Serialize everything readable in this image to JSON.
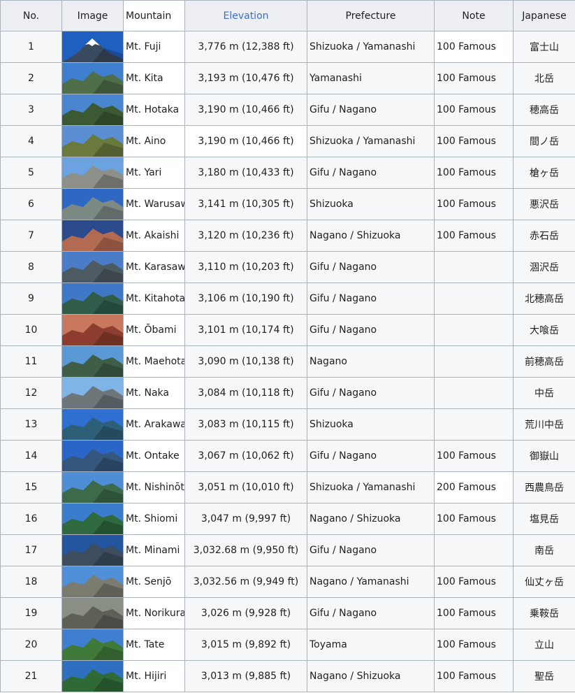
{
  "headers": [
    "No.",
    "Image",
    "Mountain",
    "Elevation",
    "Prefecture",
    "Note",
    "Japanese"
  ],
  "rows": [
    {
      "no": "1",
      "name": "Mt. Fuji",
      "elev": "3,776 m (12,388 ft)",
      "pref": "Shizuoka / Yamanashi",
      "note": "100 Famous",
      "jp": "富士山",
      "sky": "#1f5fbf",
      "rock": "#3a4a5e",
      "snow": true
    },
    {
      "no": "2",
      "name": "Mt. Kita",
      "elev": "3,193 m (10,476 ft)",
      "pref": "Yamanashi",
      "note": "100 Famous",
      "jp": "北岳",
      "sky": "#3e7fd0",
      "rock": "#4f6e4a"
    },
    {
      "no": "3",
      "name": "Mt. Hotaka",
      "elev": "3,190 m (10,466 ft)",
      "pref": "Gifu / Nagano",
      "note": "100 Famous",
      "jp": "穂高岳",
      "sky": "#4a86cf",
      "rock": "#3b5a34"
    },
    {
      "no": "4",
      "name": "Mt. Aino",
      "elev": "3,190 m (10,466 ft)",
      "pref": "Shizuoka / Yamanashi",
      "note": "100 Famous",
      "jp": "間ノ岳",
      "sky": "#5b8ed2",
      "rock": "#6a7a3c"
    },
    {
      "no": "5",
      "name": "Mt. Yari",
      "elev": "3,180 m (10,433 ft)",
      "pref": "Gifu / Nagano",
      "note": "100 Famous",
      "jp": "槍ヶ岳",
      "sky": "#6aa3e0",
      "rock": "#8c9088"
    },
    {
      "no": "6",
      "name": "Mt. Warusawa",
      "elev": "3,141 m (10,305 ft)",
      "pref": "Shizuoka",
      "note": "100 Famous",
      "jp": "悪沢岳",
      "sky": "#2f68c4",
      "rock": "#7d8a84"
    },
    {
      "no": "7",
      "name": "Mt. Akaishi",
      "elev": "3,120 m (10,236 ft)",
      "pref": "Nagano / Shizuoka",
      "note": "100 Famous",
      "jp": "赤石岳",
      "sky": "#2a4a8c",
      "rock": "#b36a52"
    },
    {
      "no": "8",
      "name": "Mt. Karasawa",
      "elev": "3,110 m (10,203 ft)",
      "pref": "Gifu / Nagano",
      "note": "",
      "jp": "涸沢岳",
      "sky": "#4a7cc8",
      "rock": "#4c5b62"
    },
    {
      "no": "9",
      "name": "Mt. Kitahotaka",
      "elev": "3,106 m (10,190 ft)",
      "pref": "Gifu / Nagano",
      "note": "",
      "jp": "北穂高岳",
      "sky": "#3f78c7",
      "rock": "#2f5d4a"
    },
    {
      "no": "10",
      "name": "Mt. Ōbami",
      "elev": "3,101 m (10,174 ft)",
      "pref": "Gifu / Nagano",
      "note": "",
      "jp": "大喰岳",
      "sky": "#c8785e",
      "rock": "#8e3e2e"
    },
    {
      "no": "11",
      "name": "Mt. Maehotaka",
      "elev": "3,090 m (10,138 ft)",
      "pref": "Nagano",
      "note": "",
      "jp": "前穂高岳",
      "sky": "#5a98d6",
      "rock": "#3e5e48"
    },
    {
      "no": "12",
      "name": "Mt. Naka",
      "elev": "3,084 m (10,118 ft)",
      "pref": "Gifu / Nagano",
      "note": "",
      "jp": "中岳",
      "sky": "#7fb4e6",
      "rock": "#6e767a"
    },
    {
      "no": "13",
      "name": "Mt. Arakawa-naka",
      "elev": "3,083 m (10,115 ft)",
      "pref": "Shizuoka",
      "note": "",
      "jp": "荒川中岳",
      "sky": "#2f6fcf",
      "rock": "#2e5f78"
    },
    {
      "no": "14",
      "name": "Mt. Ontake",
      "elev": "3,067 m (10,062 ft)",
      "pref": "Gifu / Nagano",
      "note": "100 Famous",
      "jp": "御嶽山",
      "sky": "#2a66c8",
      "rock": "#35577e"
    },
    {
      "no": "15",
      "name": "Mt. Nishinōtori",
      "elev": "3,051 m (10,010 ft)",
      "pref": "Shizuoka / Yamanashi",
      "note": "200 Famous",
      "jp": "西農鳥岳",
      "sky": "#4e8ed6",
      "rock": "#3c6a4a"
    },
    {
      "no": "16",
      "name": "Mt. Shiomi",
      "elev": "3,047 m (9,997 ft)",
      "pref": "Nagano / Shizuoka",
      "note": "100 Famous",
      "jp": "塩見岳",
      "sky": "#3a7dcc",
      "rock": "#2f6a3e"
    },
    {
      "no": "17",
      "name": "Mt. Minami",
      "elev": "3,032.68 m (9,950 ft)",
      "pref": "Gifu / Nagano",
      "note": "",
      "jp": "南岳",
      "sky": "#24559f",
      "rock": "#3d4d5e"
    },
    {
      "no": "18",
      "name": "Mt. Senjō",
      "elev": "3,032.56 m (9,949 ft)",
      "pref": "Nagano / Yamanashi",
      "note": "100 Famous",
      "jp": "仙丈ヶ岳",
      "sky": "#4f90d8",
      "rock": "#7a7c70"
    },
    {
      "no": "19",
      "name": "Mt. Norikura",
      "elev": "3,026 m (9,928 ft)",
      "pref": "Gifu / Nagano",
      "note": "100 Famous",
      "jp": "乗鞍岳",
      "sky": "#8a8f86",
      "rock": "#5e6058"
    },
    {
      "no": "20",
      "name": "Mt. Tate",
      "elev": "3,015 m (9,892 ft)",
      "pref": "Toyama",
      "note": "100 Famous",
      "jp": "立山",
      "sky": "#3f7fd0",
      "rock": "#3f7a3a"
    },
    {
      "no": "21",
      "name": "Mt. Hijiri",
      "elev": "3,013 m (9,885 ft)",
      "pref": "Nagano / Shizuoka",
      "note": "100 Famous",
      "jp": "聖岳",
      "sky": "#2f6fbf",
      "rock": "#2f6a36"
    }
  ]
}
